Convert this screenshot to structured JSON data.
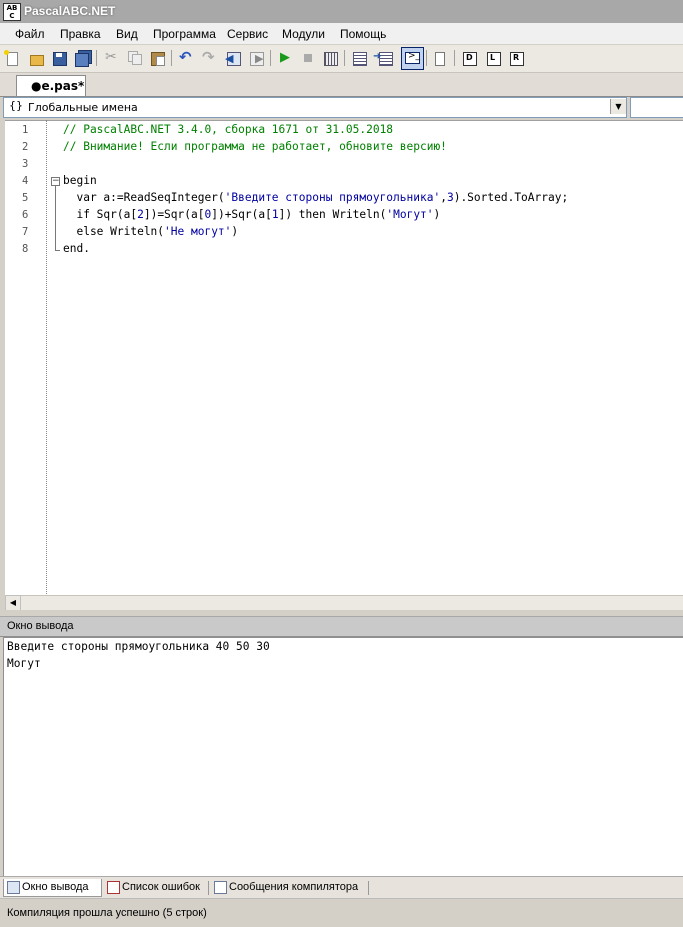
{
  "window": {
    "title": "PascalABC.NET",
    "icon_text": "AB\nC"
  },
  "menu": [
    "Файл",
    "Правка",
    "Вид",
    "Программа",
    "Сервис",
    "Модули",
    "Помощь"
  ],
  "toolbar": {
    "icons": [
      "new-file-icon",
      "open-icon",
      "save-icon",
      "save-all-icon",
      "cut-icon",
      "copy-icon",
      "paste-icon",
      "undo-icon",
      "redo-icon",
      "navigate-back-icon",
      "navigate-forward-icon",
      "run-icon",
      "stop-icon",
      "compile-icon",
      "step-into-icon",
      "step-over-icon",
      "console-icon",
      "format-icon",
      "watch-icon",
      "locals-icon",
      "breakpoints-icon"
    ]
  },
  "tab": {
    "label": "●e.pas*"
  },
  "scope": {
    "icon": "{}",
    "label": "Глобальные имена"
  },
  "editor": {
    "line_numbers": [
      "1",
      "2",
      "3",
      "4",
      "5",
      "6",
      "7",
      "8"
    ],
    "lines": [
      {
        "segments": [
          {
            "t": "// PascalABC.NET 3.4.0, сборка 1671 от 31.05.2018",
            "c": "cm"
          }
        ]
      },
      {
        "segments": [
          {
            "t": "// Внимание! Если программа не работает, обновите версию!",
            "c": "cm"
          }
        ]
      },
      {
        "segments": []
      },
      {
        "segments": [
          {
            "t": "begin",
            "c": "kw"
          }
        ]
      },
      {
        "segments": [
          {
            "t": "  var a:=ReadSeqInteger(",
            "c": "kw"
          },
          {
            "t": "'Введите стороны прямоугольника'",
            "c": "st"
          },
          {
            "t": ",",
            "c": "kw"
          },
          {
            "t": "3",
            "c": "st"
          },
          {
            "t": ").Sorted.ToArray;",
            "c": "kw"
          }
        ]
      },
      {
        "segments": [
          {
            "t": "  if Sqr(a[",
            "c": "kw"
          },
          {
            "t": "2",
            "c": "st"
          },
          {
            "t": "])=Sqr(a[",
            "c": "kw"
          },
          {
            "t": "0",
            "c": "st"
          },
          {
            "t": "])+Sqr(a[",
            "c": "kw"
          },
          {
            "t": "1",
            "c": "st"
          },
          {
            "t": "]) then Writeln(",
            "c": "kw"
          },
          {
            "t": "'Могут'",
            "c": "st"
          },
          {
            "t": ")",
            "c": "kw"
          }
        ]
      },
      {
        "segments": [
          {
            "t": "  else Writeln(",
            "c": "kw"
          },
          {
            "t": "'Не могут'",
            "c": "st"
          },
          {
            "t": ")",
            "c": "kw"
          }
        ]
      },
      {
        "segments": [
          {
            "t": "end.",
            "c": "kw"
          }
        ]
      }
    ]
  },
  "output": {
    "title": "Окно вывода",
    "lines": [
      "Введите стороны прямоугольника 40 50 30",
      "Могут"
    ]
  },
  "bottom_tabs": [
    "Окно вывода",
    "Список ошибок",
    "Сообщения компилятора"
  ],
  "status": "Компиляция прошла успешно (5 строк)"
}
